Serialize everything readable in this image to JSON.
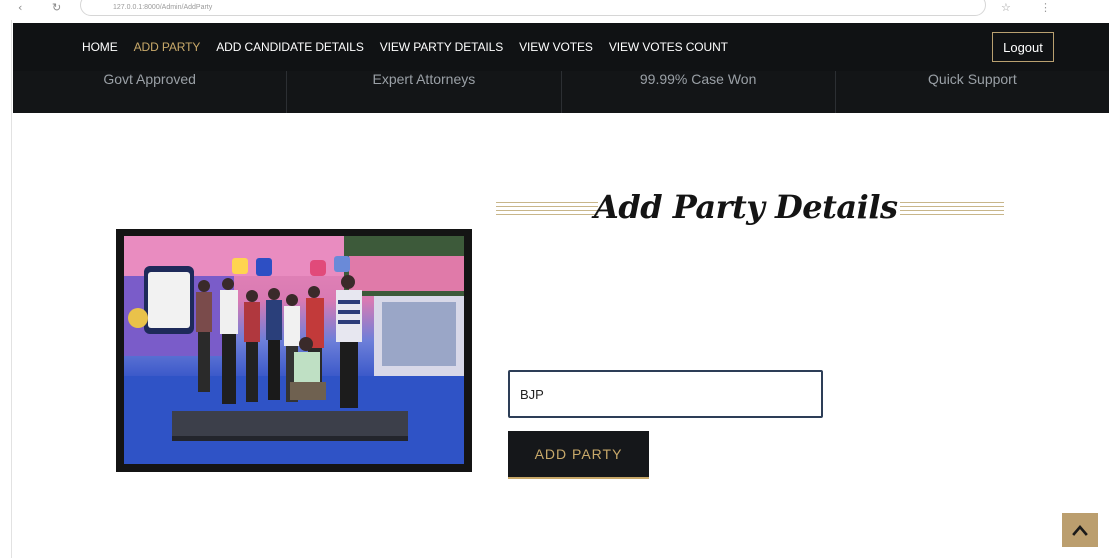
{
  "browser": {
    "back_glyph": "‹",
    "reload_glyph": "↻",
    "url": "127.0.0.1:8000/Admin/AddParty",
    "star_glyph": "☆",
    "menu_glyph": "⋮"
  },
  "nav": {
    "items": [
      {
        "label": "HOME",
        "active": false
      },
      {
        "label": "ADD PARTY",
        "active": true
      },
      {
        "label": "ADD CANDIDATE DETAILS",
        "active": false
      },
      {
        "label": "VIEW PARTY DETAILS",
        "active": false
      },
      {
        "label": "VIEW VOTES",
        "active": false
      },
      {
        "label": "VIEW VOTES COUNT",
        "active": false
      }
    ],
    "logout_label": "Logout"
  },
  "features": [
    "Govt Approved",
    "Expert Attorneys",
    "99.99% Case Won",
    "Quick Support"
  ],
  "main": {
    "heading": "Add Party Details",
    "party_input_value": "BJP",
    "add_button_label": "ADD PARTY"
  },
  "colors": {
    "nav_bg": "#101214",
    "accent_gold": "#c8a96a",
    "to_top_bg": "#bb9e6e"
  },
  "icons": {
    "scroll_top": "chevron-up-icon"
  }
}
